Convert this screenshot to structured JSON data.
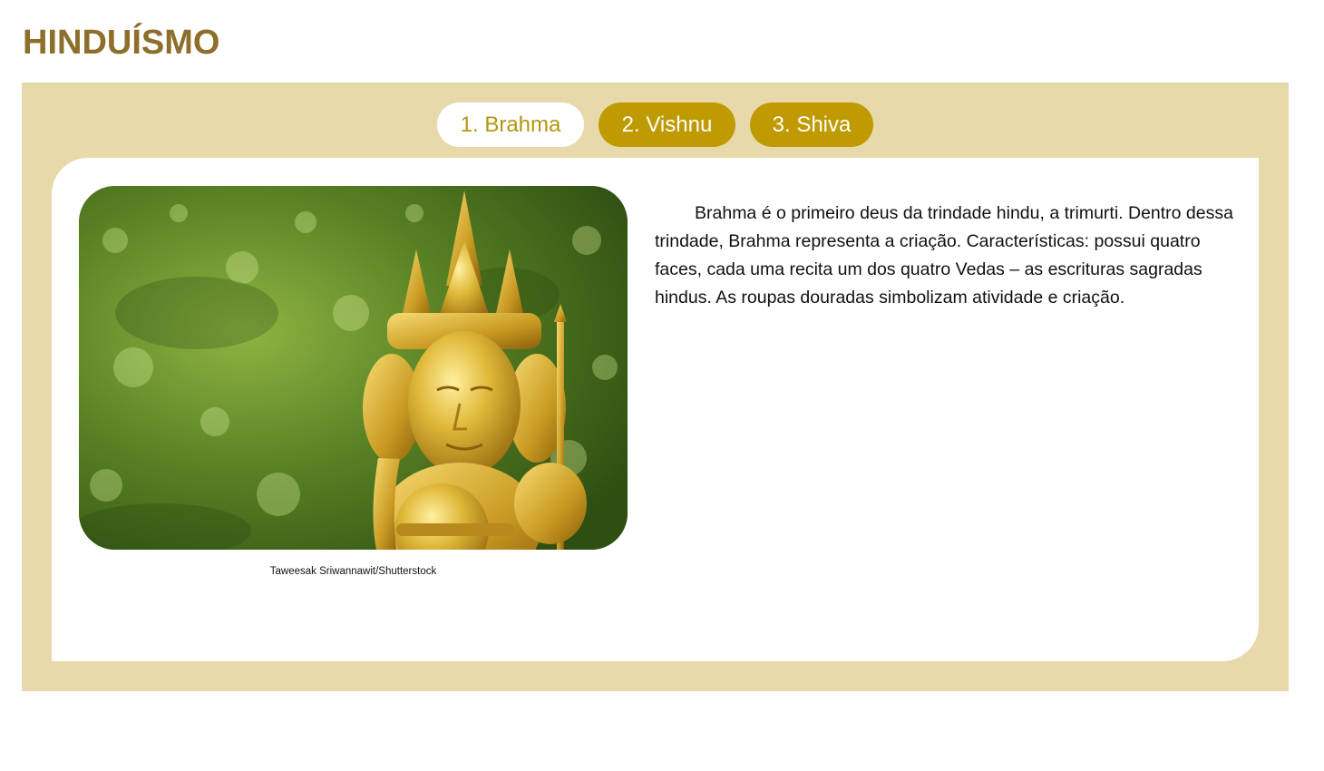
{
  "page": {
    "title": "HINDUÍSMO"
  },
  "tabs": [
    {
      "label": "1. Brahma",
      "active": true
    },
    {
      "label": "2. Vishnu",
      "active": false
    },
    {
      "label": "3. Shiva",
      "active": false
    }
  ],
  "content": {
    "image_subject": "golden four-faced Brahma statue",
    "image_credit": "Taweesak Sriwannawit/Shutterstock",
    "description": "Brahma é o primeiro deus da trindade hindu, a trimurti. Dentro dessa trindade, Brahma representa a criação. Características: possui quatro faces, cada uma recita um dos quatro Vedas – as escrituras sagradas hindus. As roupas douradas simbolizam atividade e criação."
  },
  "colors": {
    "title": "#8d6e2a",
    "panel_background": "#e8d9ab",
    "tab_inactive": "#bf9a00",
    "tab_active_text": "#b3960f",
    "card_background": "#ffffff"
  }
}
